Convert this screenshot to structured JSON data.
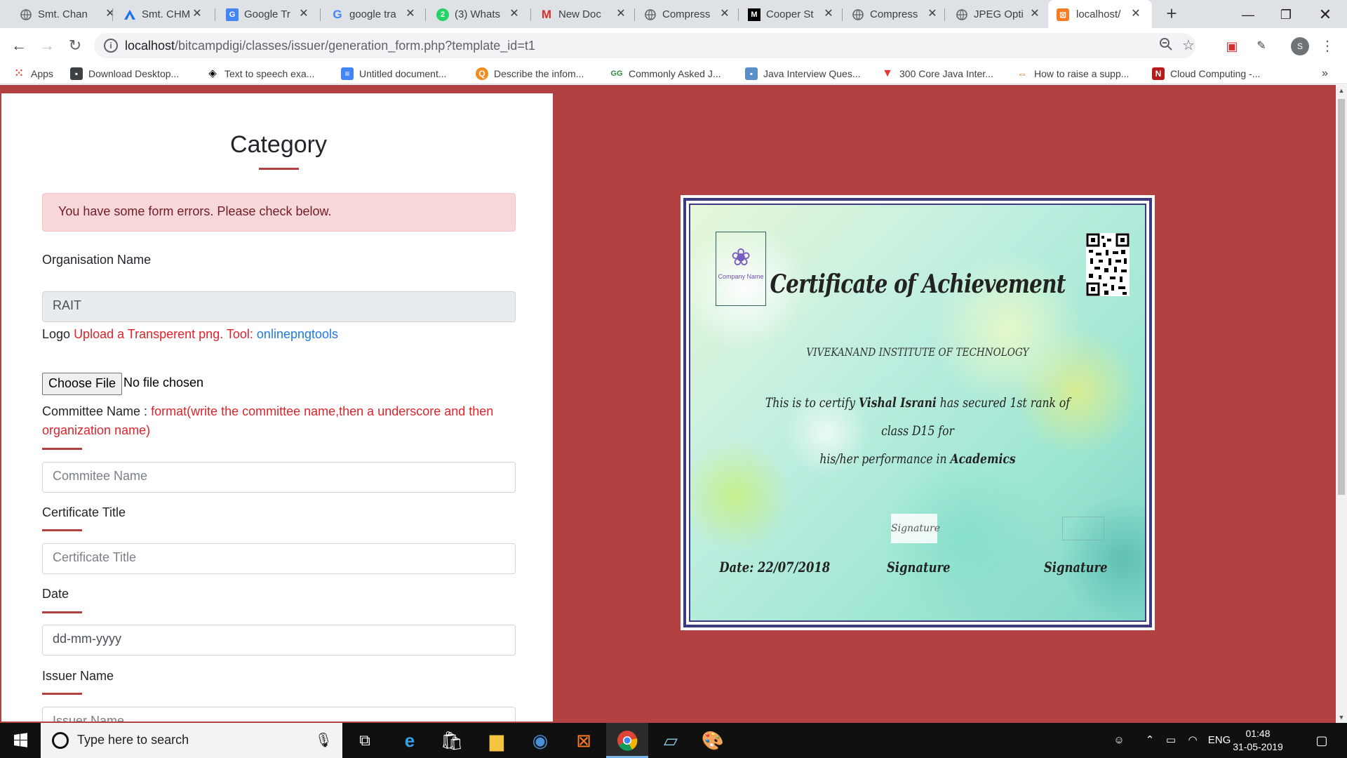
{
  "browser": {
    "tabs": [
      {
        "label": "Smt. Chan",
        "icon": "globe-icon",
        "color": "#5f6368"
      },
      {
        "label": "Smt. CHM",
        "icon": "triangle-a-icon",
        "color": "#1a73e8"
      },
      {
        "label": "Google Tr",
        "icon": "google-translate-icon",
        "color": "#4285f4"
      },
      {
        "label": "google tra",
        "icon": "google-icon",
        "color": "#4285f4"
      },
      {
        "label": "(3) Whats",
        "icon": "whatsapp-icon",
        "color": "#25d366"
      },
      {
        "label": "New Doc",
        "icon": "gmail-icon",
        "color": "#d93025"
      },
      {
        "label": "Compress",
        "icon": "globe-icon",
        "color": "#5f6368"
      },
      {
        "label": "Cooper St",
        "icon": "m-logo-icon",
        "color": "#000000"
      },
      {
        "label": "Compress",
        "icon": "globe-icon",
        "color": "#5f6368"
      },
      {
        "label": "JPEG Opti",
        "icon": "globe-icon",
        "color": "#5f6368"
      },
      {
        "label": "localhost/",
        "icon": "xampp-icon",
        "color": "#fb7a24",
        "active": true
      }
    ],
    "url_host": "localhost",
    "url_path": "/bitcampdigi/classes/issuer/generation_form.php?template_id=t1",
    "avatar_letter": "S",
    "bookmarks": [
      {
        "label": "Apps",
        "icon": "apps-grid-icon",
        "color": "#ea4335"
      },
      {
        "label": "Download Desktop...",
        "icon": "bookmark-page-icon",
        "color": "#3c4043"
      },
      {
        "label": "Text to speech exa...",
        "icon": "codepen-icon",
        "color": "#000000"
      },
      {
        "label": "Untitled document...",
        "icon": "google-docs-icon",
        "color": "#4285f4"
      },
      {
        "label": "Describe the infom...",
        "icon": "quora-icon",
        "color": "#f28b20"
      },
      {
        "label": "Commonly Asked J...",
        "icon": "geeksforgeeks-icon",
        "color": "#2f8d46"
      },
      {
        "label": "Java Interview Ques...",
        "icon": "bookmark-page-icon",
        "color": "#5b8fc7"
      },
      {
        "label": "300 Core Java Inter...",
        "icon": "v-logo-icon",
        "color": "#e53935"
      },
      {
        "label": "How to raise a supp...",
        "icon": "link-icon",
        "color": "#f26522"
      },
      {
        "label": "Cloud Computing -...",
        "icon": "n-logo-icon",
        "color": "#b71c1c"
      }
    ]
  },
  "form": {
    "heading": "Category",
    "error_alert": "You have some form errors. Please check below.",
    "org_label": "Organisation Name",
    "org_value": "RAIT",
    "logo_label": "Logo",
    "logo_hint": "Upload a Transperent png. Tool:",
    "logo_link": "onlinepngtools",
    "file_button": "Choose File",
    "file_status": "No file chosen",
    "committee_label": "Committee Name :",
    "committee_hint_1": "format(write the committee name,then a underscore and then",
    "committee_hint_2": "organization name)",
    "committee_placeholder": "Commitee Name",
    "cert_title_label": "Certificate Title",
    "cert_title_placeholder": "Certificate Title",
    "date_label": "Date",
    "date_placeholder": "dd-mm-yyyy",
    "issuer_label": "Issuer Name",
    "issuer_placeholder": "Issuer Name"
  },
  "certificate": {
    "logo_text": "Company Name",
    "title": "Certificate of Achievement",
    "organization": "VIVEKANAND INSTITUTE OF TECHNOLOGY",
    "body_1": "This is to certify",
    "recipient": "Vishal Israni",
    "body_2": "has secured 1st rank of class D15 for",
    "body_3": "his/her performance in",
    "field": "Academics",
    "date": "Date: 22/07/2018",
    "signature_image_text": "Signature",
    "signature_1": "Signature",
    "signature_2": "Signature"
  },
  "taskbar": {
    "search_placeholder": "Type here to search",
    "language": "ENG",
    "time": "01:48",
    "date": "31-05-2019",
    "pinned": [
      "task-view-icon",
      "edge-icon",
      "store-icon",
      "file-explorer-icon",
      "app-icon",
      "xampp-icon",
      "chrome-icon",
      "notepad-icon",
      "paint-icon"
    ]
  },
  "colors": {
    "accent": "#b24141",
    "error_bg": "#f8d7da",
    "error_text": "#721c24",
    "hint_red": "#e0232a",
    "link_blue": "#1e7be6"
  }
}
